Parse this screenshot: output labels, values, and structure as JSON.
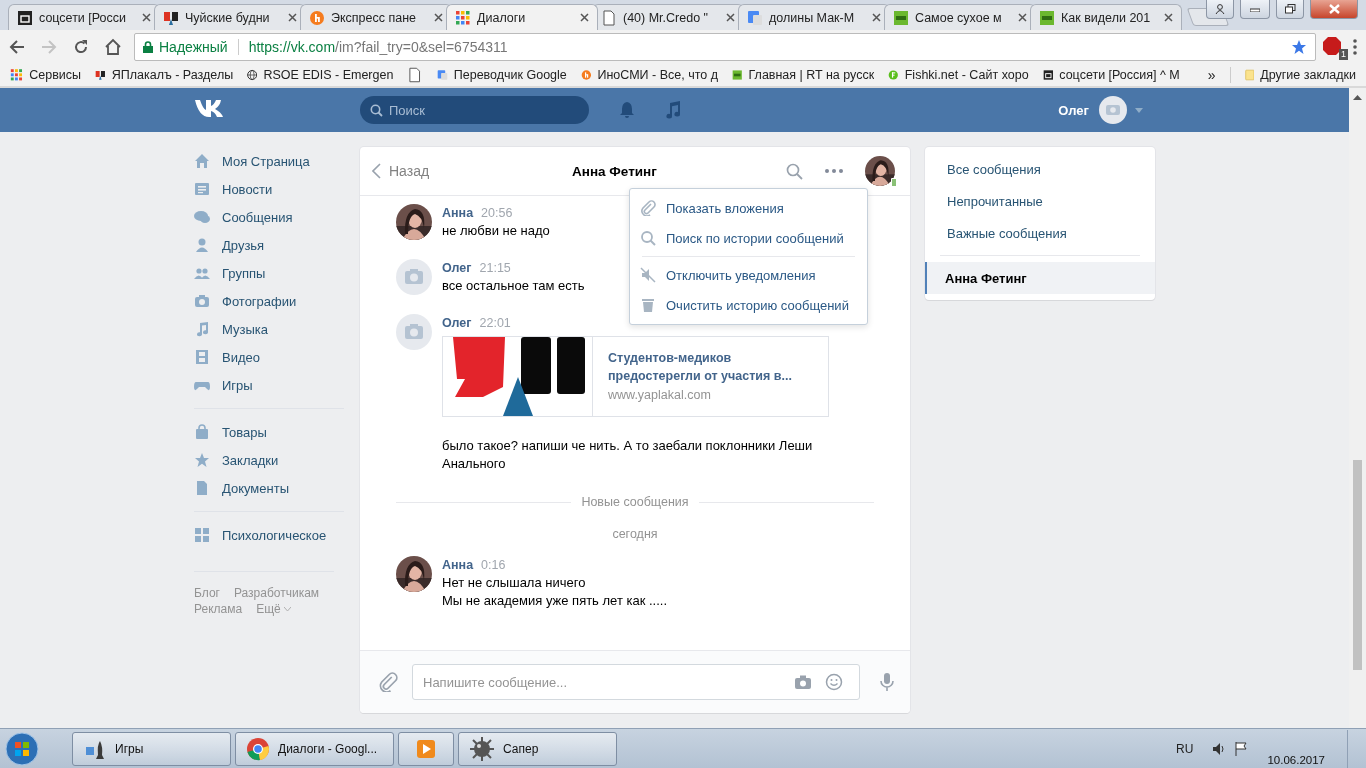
{
  "browser": {
    "tabs": [
      {
        "title": "соцсети [Росси",
        "selected": false
      },
      {
        "title": "Чуйские будни",
        "selected": false
      },
      {
        "title": "Экспресс пане",
        "selected": false
      },
      {
        "title": "Диалоги",
        "selected": true
      },
      {
        "title": "(40) Mr.Credo \"",
        "selected": false
      },
      {
        "title": "долины Мак-М",
        "selected": false
      },
      {
        "title": "Самое сухое м",
        "selected": false
      },
      {
        "title": "Как видели 201",
        "selected": false
      }
    ],
    "address": {
      "secure_label": "Надежный",
      "url_host": "https://vk.com",
      "url_path": "/im?fail_try=0&sel=6754311"
    },
    "extension_badge": "1",
    "bookmarks": [
      {
        "label": "Сервисы"
      },
      {
        "label": "ЯПлакалъ - Разделы"
      },
      {
        "label": "RSOE EDIS - Emergen"
      },
      {
        "kind": "icon_only"
      },
      {
        "label": "Переводчик Google"
      },
      {
        "label": "ИноСМИ - Все, что д"
      },
      {
        "label": "Главная | RT на русск"
      },
      {
        "label": "Fishki.net - Сайт хоро"
      },
      {
        "label": "соцсети [Россия] ^ М"
      }
    ],
    "bookmarks_overflow": "»",
    "other_bookmarks": "Другие закладки"
  },
  "header": {
    "search_placeholder": "Поиск",
    "user_name": "Олег"
  },
  "sidebar": {
    "groups": [
      [
        {
          "label": "Моя Страница"
        },
        {
          "label": "Новости"
        },
        {
          "label": "Сообщения"
        },
        {
          "label": "Друзья"
        },
        {
          "label": "Группы"
        },
        {
          "label": "Фотографии"
        },
        {
          "label": "Музыка"
        },
        {
          "label": "Видео"
        },
        {
          "label": "Игры"
        }
      ],
      [
        {
          "label": "Товары"
        },
        {
          "label": "Закладки"
        },
        {
          "label": "Документы"
        }
      ],
      [
        {
          "label": "Психологическое"
        }
      ]
    ],
    "footer_links": [
      "Блог",
      "Разработчикам",
      "Реклама",
      "Ещё"
    ]
  },
  "chat": {
    "back": "Назад",
    "title": "Анна Фетинг",
    "peer_online_mobile": true,
    "menu": [
      [
        {
          "label": "Показать вложения"
        },
        {
          "label": "Поиск по истории сообщений"
        }
      ],
      [
        {
          "label": "Отключить уведомления"
        },
        {
          "label": "Очистить историю сообщений"
        }
      ]
    ],
    "messages": [
      {
        "kind": "message",
        "author": "Анна",
        "time": "20:56",
        "has_photo": true,
        "lines": [
          "не любви не надо"
        ]
      },
      {
        "kind": "message",
        "author": "Олег",
        "time": "21:15",
        "has_photo": false,
        "lines": [
          "все остальное там есть"
        ]
      },
      {
        "kind": "message",
        "author": "Олег",
        "time": "22:01",
        "has_photo": false,
        "attachment": {
          "title": "Студентов-медиков предостерегли от участия в...",
          "domain": "www.yaplakal.com"
        },
        "lines": [
          "было такое? напиши че нить. А то заебали поклонники Леши Анального"
        ]
      },
      {
        "kind": "divider",
        "label": "Новые сообщения"
      },
      {
        "kind": "date",
        "label": "сегодня"
      },
      {
        "kind": "message",
        "author": "Анна",
        "time": "0:16",
        "has_photo": true,
        "lines": [
          "Нет не слышала ничего",
          "Мы не академия уже пять лет как ....."
        ]
      }
    ],
    "composer_placeholder": "Напишите сообщение..."
  },
  "folders": [
    {
      "label": "Все сообщения",
      "selected": false
    },
    {
      "label": "Непрочитанные",
      "selected": false
    },
    {
      "label": "Важные сообщения",
      "selected": false
    },
    {
      "label": "Анна Фетинг",
      "selected": true
    }
  ],
  "taskbar": {
    "items": [
      {
        "kind": "app",
        "label": "Игры"
      },
      {
        "kind": "app",
        "label": "Диалоги - Googl..."
      },
      {
        "kind": "icon_only"
      },
      {
        "kind": "app",
        "label": "Сапер"
      }
    ],
    "language": "RU",
    "date": "10.06.2017"
  }
}
